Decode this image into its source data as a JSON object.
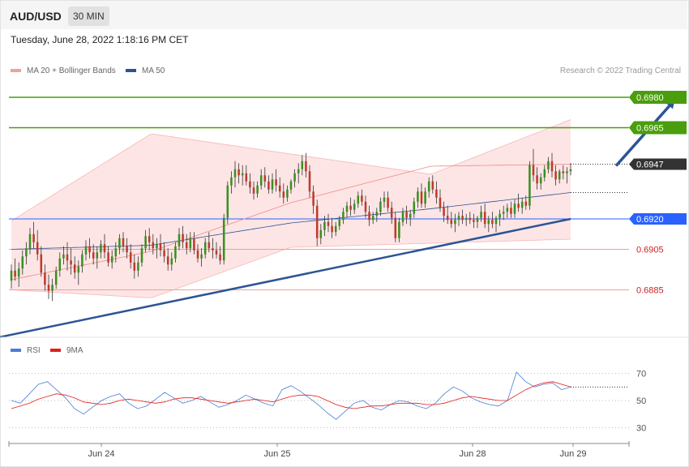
{
  "header": {
    "symbol": "AUD/USD",
    "timeframe": "30 MIN"
  },
  "datetime": "Tuesday, June 28, 2022 1:18:16 PM CET",
  "legend": {
    "ma20": "MA 20 + Bollinger Bands",
    "ma50": "MA 50"
  },
  "credit": "Research © 2022 Trading Central",
  "colors": {
    "green": "#4a9d0c",
    "blue": "#2962ff",
    "red": "#e8837e",
    "navy": "#2c5494",
    "up": "#3a8f22",
    "down": "#c0392b",
    "bb_fill": "#fde2e2"
  },
  "chart_data": [
    {
      "type": "candlestick",
      "ylim": [
        0.6862,
        0.6988
      ],
      "x_ticks": [
        "Jun 24",
        "Jun 25",
        "Jun 28",
        "Jun 29"
      ],
      "levels": [
        {
          "label": "0.6980",
          "value": 0.698,
          "kind": "resistance"
        },
        {
          "label": "0.6965",
          "value": 0.6965,
          "kind": "resistance"
        },
        {
          "label": "0.6947",
          "value": 0.6947,
          "kind": "last"
        },
        {
          "label": "0.6920",
          "value": 0.692,
          "kind": "pivot"
        },
        {
          "label": "0.6905",
          "value": 0.6905,
          "kind": "support"
        },
        {
          "label": "0.6885",
          "value": 0.6885,
          "kind": "support"
        }
      ],
      "trendline": [
        [
          0,
          0.6862
        ],
        [
          150,
          0.692
        ]
      ],
      "forecast_arrow": [
        [
          160,
          0.6947
        ],
        [
          177,
          0.698
        ]
      ],
      "candles": [
        [
          0.68895,
          0.68975,
          0.68855,
          0.68945
        ],
        [
          0.68945,
          0.69005,
          0.68895,
          0.68915
        ],
        [
          0.68915,
          0.68985,
          0.68865,
          0.68955
        ],
        [
          0.68955,
          0.69045,
          0.68925,
          0.69015
        ],
        [
          0.69015,
          0.69085,
          0.68975,
          0.69055
        ],
        [
          0.69055,
          0.69155,
          0.69025,
          0.69125
        ],
        [
          0.69125,
          0.69185,
          0.69055,
          0.69085
        ],
        [
          0.69085,
          0.69145,
          0.68995,
          0.69025
        ],
        [
          0.69025,
          0.69065,
          0.68915,
          0.68935
        ],
        [
          0.68935,
          0.68975,
          0.68845,
          0.68875
        ],
        [
          0.68875,
          0.68925,
          0.68805,
          0.68845
        ],
        [
          0.68845,
          0.68905,
          0.68795,
          0.68875
        ],
        [
          0.68875,
          0.68965,
          0.68855,
          0.68945
        ],
        [
          0.68945,
          0.69035,
          0.68915,
          0.69005
        ],
        [
          0.69005,
          0.69065,
          0.68975,
          0.69025
        ],
        [
          0.69025,
          0.69085,
          0.68945,
          0.68995
        ],
        [
          0.68995,
          0.69055,
          0.68925,
          0.68975
        ],
        [
          0.68975,
          0.69015,
          0.68905,
          0.68935
        ],
        [
          0.68935,
          0.68995,
          0.68875,
          0.68965
        ],
        [
          0.68965,
          0.69045,
          0.68935,
          0.69025
        ],
        [
          0.69025,
          0.69095,
          0.68995,
          0.69065
        ],
        [
          0.69065,
          0.69105,
          0.69005,
          0.69035
        ],
        [
          0.69035,
          0.69075,
          0.68975,
          0.69005
        ],
        [
          0.69005,
          0.69065,
          0.68955,
          0.69035
        ],
        [
          0.69035,
          0.69095,
          0.69005,
          0.69075
        ],
        [
          0.69075,
          0.69125,
          0.69005,
          0.69035
        ],
        [
          0.69035,
          0.69065,
          0.68965,
          0.68985
        ],
        [
          0.68985,
          0.69045,
          0.68955,
          0.69015
        ],
        [
          0.69015,
          0.69085,
          0.68985,
          0.69055
        ],
        [
          0.69055,
          0.69125,
          0.69025,
          0.69105
        ],
        [
          0.69105,
          0.69135,
          0.69035,
          0.69065
        ],
        [
          0.69065,
          0.69105,
          0.69005,
          0.69035
        ],
        [
          0.69035,
          0.69075,
          0.68955,
          0.68985
        ],
        [
          0.68985,
          0.69025,
          0.68905,
          0.68945
        ],
        [
          0.68945,
          0.69015,
          0.68915,
          0.68985
        ],
        [
          0.68985,
          0.69075,
          0.68965,
          0.69055
        ],
        [
          0.69055,
          0.69145,
          0.69035,
          0.69115
        ],
        [
          0.69115,
          0.69155,
          0.69045,
          0.69085
        ],
        [
          0.69085,
          0.69125,
          0.69025,
          0.69055
        ],
        [
          0.69055,
          0.69105,
          0.69005,
          0.69075
        ],
        [
          0.69075,
          0.69125,
          0.69015,
          0.69045
        ],
        [
          0.69045,
          0.69085,
          0.68985,
          0.69015
        ],
        [
          0.69015,
          0.69055,
          0.68945,
          0.68975
        ],
        [
          0.68975,
          0.69035,
          0.68945,
          0.69005
        ],
        [
          0.69005,
          0.69085,
          0.68985,
          0.69065
        ],
        [
          0.69065,
          0.69155,
          0.69045,
          0.69125
        ],
        [
          0.69125,
          0.69165,
          0.69055,
          0.69085
        ],
        [
          0.69085,
          0.69125,
          0.69025,
          0.69055
        ],
        [
          0.69055,
          0.69135,
          0.69035,
          0.69105
        ],
        [
          0.69105,
          0.69135,
          0.69025,
          0.69045
        ],
        [
          0.69045,
          0.69075,
          0.68985,
          0.69005
        ],
        [
          0.69005,
          0.69055,
          0.68965,
          0.69025
        ],
        [
          0.69025,
          0.69105,
          0.69005,
          0.69085
        ],
        [
          0.69085,
          0.69135,
          0.69035,
          0.69055
        ],
        [
          0.69055,
          0.69105,
          0.69005,
          0.69045
        ],
        [
          0.69045,
          0.69085,
          0.69005,
          0.69025
        ],
        [
          0.69025,
          0.69065,
          0.68975,
          0.68995
        ],
        [
          0.68995,
          0.69225,
          0.68975,
          0.69205
        ],
        [
          0.69205,
          0.69385,
          0.69175,
          0.69365
        ],
        [
          0.69365,
          0.69435,
          0.69325,
          0.69405
        ],
        [
          0.69405,
          0.69485,
          0.69355,
          0.69445
        ],
        [
          0.69445,
          0.69475,
          0.69375,
          0.69415
        ],
        [
          0.69415,
          0.69465,
          0.69365,
          0.69425
        ],
        [
          0.69425,
          0.69465,
          0.69365,
          0.69385
        ],
        [
          0.69385,
          0.69425,
          0.69325,
          0.69355
        ],
        [
          0.69355,
          0.69385,
          0.69295,
          0.69325
        ],
        [
          0.69325,
          0.69385,
          0.69305,
          0.69365
        ],
        [
          0.69365,
          0.69445,
          0.69345,
          0.69415
        ],
        [
          0.69415,
          0.69455,
          0.69355,
          0.69385
        ],
        [
          0.69385,
          0.69415,
          0.69325,
          0.69345
        ],
        [
          0.69345,
          0.69425,
          0.69325,
          0.69395
        ],
        [
          0.69395,
          0.69445,
          0.69335,
          0.69365
        ],
        [
          0.69365,
          0.69405,
          0.69305,
          0.69335
        ],
        [
          0.69335,
          0.69375,
          0.69275,
          0.69305
        ],
        [
          0.69305,
          0.69365,
          0.69285,
          0.69345
        ],
        [
          0.69345,
          0.69395,
          0.69325,
          0.69385
        ],
        [
          0.69385,
          0.69445,
          0.69355,
          0.69425
        ],
        [
          0.69425,
          0.69475,
          0.69375,
          0.69445
        ],
        [
          0.69445,
          0.69515,
          0.69415,
          0.69485
        ],
        [
          0.69485,
          0.69525,
          0.69405,
          0.69435
        ],
        [
          0.69435,
          0.69465,
          0.69305,
          0.69335
        ],
        [
          0.69335,
          0.69365,
          0.69225,
          0.69265
        ],
        [
          0.69265,
          0.69295,
          0.69065,
          0.69105
        ],
        [
          0.69105,
          0.69175,
          0.69075,
          0.69145
        ],
        [
          0.69145,
          0.69215,
          0.69115,
          0.69185
        ],
        [
          0.69185,
          0.69225,
          0.69135,
          0.69165
        ],
        [
          0.69165,
          0.69205,
          0.69105,
          0.69135
        ],
        [
          0.69135,
          0.69185,
          0.69115,
          0.69165
        ],
        [
          0.69165,
          0.69215,
          0.69145,
          0.69195
        ],
        [
          0.69195,
          0.69255,
          0.69175,
          0.69235
        ],
        [
          0.69235,
          0.69285,
          0.69205,
          0.69265
        ],
        [
          0.69265,
          0.69305,
          0.69215,
          0.69245
        ],
        [
          0.69245,
          0.69295,
          0.69225,
          0.69275
        ],
        [
          0.69275,
          0.69335,
          0.69255,
          0.69315
        ],
        [
          0.69315,
          0.69345,
          0.69265,
          0.69285
        ],
        [
          0.69285,
          0.69315,
          0.69205,
          0.69235
        ],
        [
          0.69235,
          0.69265,
          0.69165,
          0.69195
        ],
        [
          0.69195,
          0.69235,
          0.69175,
          0.69215
        ],
        [
          0.69215,
          0.69255,
          0.69185,
          0.69235
        ],
        [
          0.69235,
          0.69305,
          0.69215,
          0.69285
        ],
        [
          0.69285,
          0.69335,
          0.69255,
          0.69305
        ],
        [
          0.69305,
          0.69335,
          0.69235,
          0.69255
        ],
        [
          0.69255,
          0.69285,
          0.69175,
          0.69205
        ],
        [
          0.69205,
          0.69235,
          0.69085,
          0.69105
        ],
        [
          0.69105,
          0.69205,
          0.69085,
          0.69185
        ],
        [
          0.69185,
          0.69255,
          0.69165,
          0.69235
        ],
        [
          0.69235,
          0.69265,
          0.69175,
          0.69205
        ],
        [
          0.69205,
          0.69245,
          0.69165,
          0.69225
        ],
        [
          0.69225,
          0.69305,
          0.69205,
          0.69285
        ],
        [
          0.69285,
          0.69355,
          0.69255,
          0.69335
        ],
        [
          0.69335,
          0.69375,
          0.69255,
          0.69275
        ],
        [
          0.69275,
          0.69355,
          0.69255,
          0.69335
        ],
        [
          0.69335,
          0.69405,
          0.69305,
          0.69385
        ],
        [
          0.69385,
          0.69415,
          0.69325,
          0.69345
        ],
        [
          0.69345,
          0.69385,
          0.69275,
          0.69305
        ],
        [
          0.69305,
          0.69345,
          0.69235,
          0.69255
        ],
        [
          0.69255,
          0.69285,
          0.69185,
          0.69215
        ],
        [
          0.69215,
          0.69265,
          0.69175,
          0.69195
        ],
        [
          0.69195,
          0.69235,
          0.69155,
          0.69175
        ],
        [
          0.69175,
          0.69225,
          0.69135,
          0.69195
        ],
        [
          0.69195,
          0.69235,
          0.69165,
          0.69215
        ],
        [
          0.69215,
          0.69245,
          0.69175,
          0.69195
        ],
        [
          0.69195,
          0.69225,
          0.69165,
          0.69205
        ],
        [
          0.69205,
          0.69235,
          0.69175,
          0.69195
        ],
        [
          0.69195,
          0.69225,
          0.69155,
          0.69185
        ],
        [
          0.69185,
          0.69215,
          0.69155,
          0.69205
        ],
        [
          0.69205,
          0.69265,
          0.69185,
          0.69235
        ],
        [
          0.69235,
          0.69275,
          0.69155,
          0.69175
        ],
        [
          0.69175,
          0.69215,
          0.69135,
          0.69195
        ],
        [
          0.69195,
          0.69235,
          0.69155,
          0.69175
        ],
        [
          0.69175,
          0.69215,
          0.69135,
          0.69205
        ],
        [
          0.69205,
          0.69245,
          0.69165,
          0.69225
        ],
        [
          0.69225,
          0.69265,
          0.69195,
          0.69235
        ],
        [
          0.69235,
          0.69275,
          0.69205,
          0.69255
        ],
        [
          0.69255,
          0.69285,
          0.69205,
          0.69225
        ],
        [
          0.69225,
          0.69295,
          0.69205,
          0.69275
        ],
        [
          0.69275,
          0.69325,
          0.69235,
          0.69255
        ],
        [
          0.69255,
          0.69305,
          0.69225,
          0.69285
        ],
        [
          0.69285,
          0.69315,
          0.69245,
          0.69265
        ],
        [
          0.69265,
          0.69485,
          0.69245,
          0.69465
        ],
        [
          0.69465,
          0.69545,
          0.69385,
          0.69415
        ],
        [
          0.69415,
          0.69455,
          0.69345,
          0.69375
        ],
        [
          0.69375,
          0.69425,
          0.69345,
          0.69405
        ],
        [
          0.69405,
          0.69465,
          0.69385,
          0.69445
        ],
        [
          0.69445,
          0.69505,
          0.69425,
          0.69485
        ],
        [
          0.69485,
          0.69525,
          0.69405,
          0.69435
        ],
        [
          0.69435,
          0.69465,
          0.69365,
          0.69395
        ],
        [
          0.69395,
          0.69445,
          0.69375,
          0.69435
        ],
        [
          0.69435,
          0.69465,
          0.69395,
          0.69425
        ],
        [
          0.69425,
          0.69455,
          0.69375,
          0.69435
        ],
        [
          0.69435,
          0.69475,
          0.69415,
          0.69445
        ]
      ],
      "ma20": [
        0.689,
        0.6904,
        0.6928,
        0.6946,
        0.6947
      ],
      "ma50": [
        0.6905,
        0.6907,
        0.6918,
        0.6925,
        0.6933
      ],
      "bollinger_upper": [
        0.6919,
        0.6962,
        0.6952,
        0.6942,
        0.6969
      ],
      "bollinger_lower": [
        0.6885,
        0.6881,
        0.6906,
        0.6908,
        0.691
      ]
    },
    {
      "type": "line",
      "legend": [
        "RSI",
        "9MA"
      ],
      "ylim": [
        20,
        80
      ],
      "y_ticks": [
        70,
        50,
        30
      ],
      "series": [
        {
          "name": "RSI",
          "values": [
            50,
            48,
            55,
            62,
            64,
            58,
            52,
            44,
            40,
            45,
            50,
            53,
            55,
            48,
            44,
            46,
            51,
            56,
            52,
            48,
            50,
            53,
            49,
            45,
            47,
            50,
            54,
            51,
            48,
            46,
            58,
            61,
            57,
            52,
            47,
            41,
            36,
            42,
            48,
            50,
            45,
            43,
            47,
            50,
            49,
            46,
            44,
            48,
            55,
            60,
            57,
            52,
            49,
            47,
            46,
            50,
            71,
            64,
            60,
            62,
            63,
            58,
            60
          ]
        },
        {
          "name": "9MA",
          "values": [
            44,
            46,
            48,
            51,
            53,
            55,
            54,
            52,
            49,
            48,
            47,
            48,
            50,
            51,
            50,
            49,
            48,
            49,
            51,
            52,
            52,
            51,
            50,
            49,
            48,
            49,
            50,
            51,
            50,
            49,
            51,
            53,
            54,
            54,
            53,
            50,
            47,
            45,
            44,
            45,
            46,
            46,
            47,
            48,
            48,
            48,
            47,
            47,
            48,
            50,
            52,
            53,
            52,
            51,
            50,
            50,
            54,
            58,
            61,
            63,
            64,
            62,
            60
          ]
        }
      ]
    }
  ]
}
